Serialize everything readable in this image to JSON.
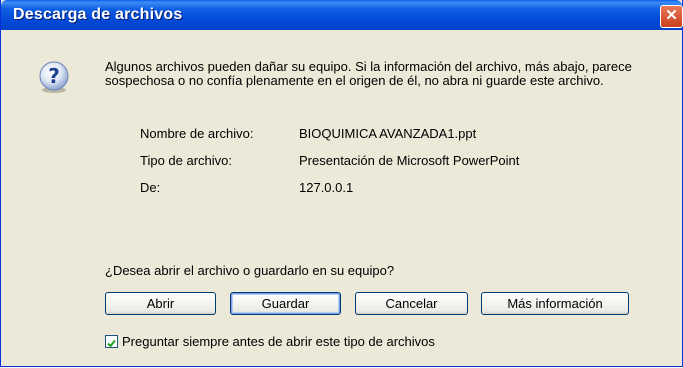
{
  "window": {
    "title": "Descarga de archivos",
    "close_glyph": "✕",
    "titlebar_color": "#0a5ee8",
    "face_color": "#ece9d8"
  },
  "icon": {
    "name": "question-icon"
  },
  "message": "Algunos archivos pueden dañar su equipo. Si la información del archivo, más abajo, parece sospechosa o no confía plenamente en el origen de él, no abra ni guarde este archivo.",
  "file_info": [
    {
      "label": "Nombre de archivo:",
      "value": "BIOQUIMICA AVANZADA1.ppt"
    },
    {
      "label": "Tipo de archivo:",
      "value": "Presentación de Microsoft PowerPoint"
    },
    {
      "label": "De:",
      "value": "127.0.0.1"
    }
  ],
  "question": "¿Desea abrir el archivo o guardarlo en su equipo?",
  "buttons": {
    "open": "Abrir",
    "save": "Guardar",
    "cancel": "Cancelar",
    "more_info": "Más información"
  },
  "checkbox": {
    "label": "Preguntar siempre antes de abrir este tipo de archivos",
    "checked": true
  }
}
